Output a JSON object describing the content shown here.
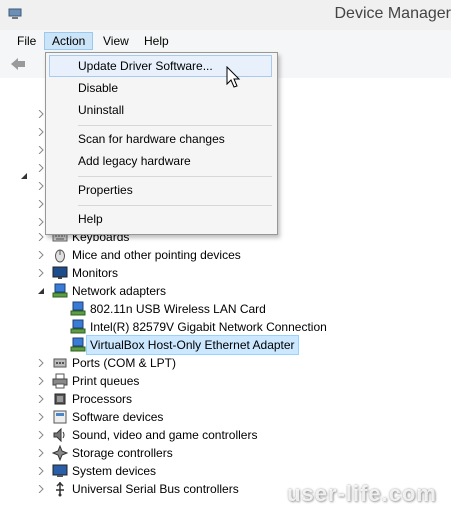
{
  "window": {
    "title": "Device Manager"
  },
  "menubar": [
    "File",
    "Action",
    "View",
    "Help"
  ],
  "action_menu": {
    "items": [
      "Update Driver Software...",
      "Disable",
      "Uninstall",
      "Scan for hardware changes",
      "Add legacy hardware",
      "Properties",
      "Help"
    ],
    "highlighted": "Update Driver Software..."
  },
  "tree": [
    {
      "label": "Keyboards",
      "icon": "keyboard-icon",
      "expanded": false
    },
    {
      "label": "Mice and other pointing devices",
      "icon": "mouse-icon",
      "expanded": false
    },
    {
      "label": "Monitors",
      "icon": "monitor-icon",
      "expanded": false
    },
    {
      "label": "Network adapters",
      "icon": "network-adapter-icon",
      "expanded": true,
      "children": [
        {
          "label": "802.11n USB Wireless LAN Card",
          "icon": "network-adapter-icon"
        },
        {
          "label": "Intel(R) 82579V Gigabit Network Connection",
          "icon": "network-adapter-icon"
        },
        {
          "label": "VirtualBox Host-Only Ethernet Adapter",
          "icon": "network-adapter-icon",
          "selected": true
        }
      ]
    },
    {
      "label": "Ports (COM & LPT)",
      "icon": "port-icon",
      "expanded": false
    },
    {
      "label": "Print queues",
      "icon": "printer-icon",
      "expanded": false
    },
    {
      "label": "Processors",
      "icon": "processor-icon",
      "expanded": false
    },
    {
      "label": "Software devices",
      "icon": "software-device-icon",
      "expanded": false
    },
    {
      "label": "Sound, video and game controllers",
      "icon": "sound-icon",
      "expanded": false
    },
    {
      "label": "Storage controllers",
      "icon": "storage-icon",
      "expanded": false
    },
    {
      "label": "System devices",
      "icon": "system-icon",
      "expanded": false
    },
    {
      "label": "Universal Serial Bus controllers",
      "icon": "usb-icon",
      "expanded": false
    }
  ],
  "watermark": "user-life.com",
  "colors": {
    "selection": "#cce8ff",
    "menu_open": "#cce4f7",
    "hover": "#e8f1fb"
  }
}
